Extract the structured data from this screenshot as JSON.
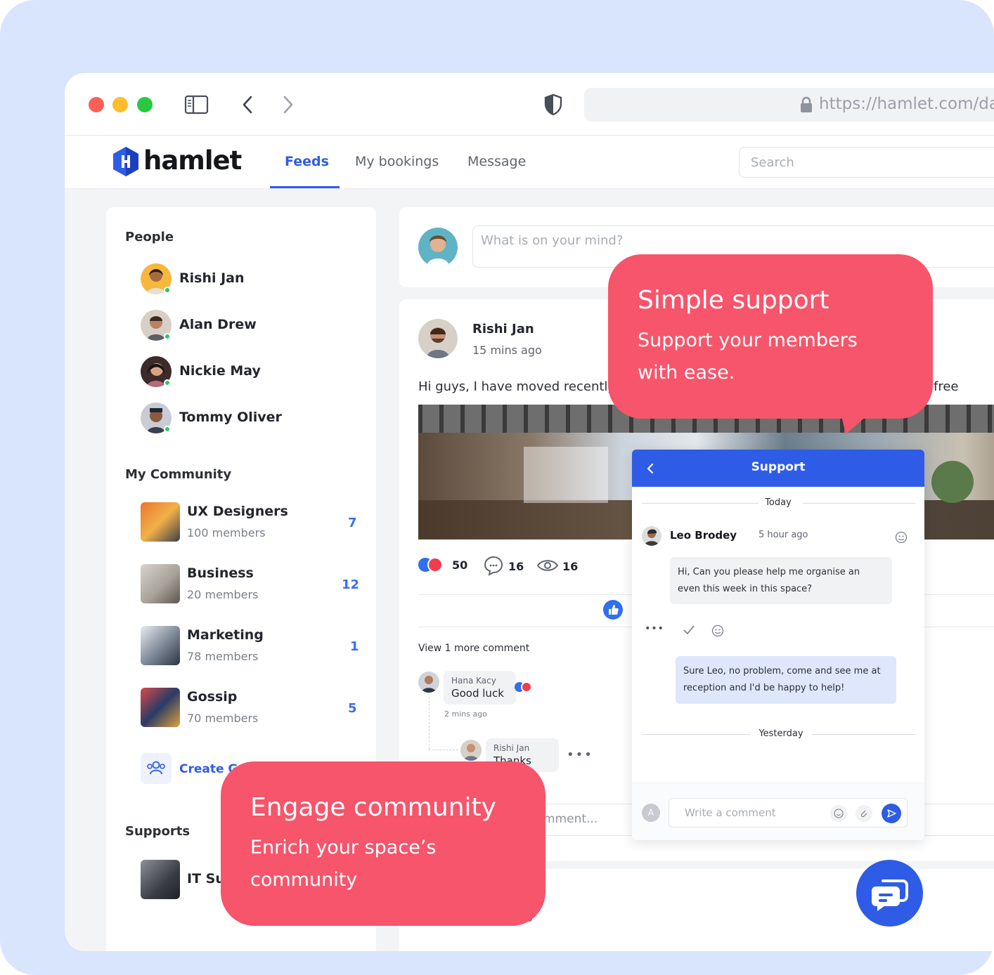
{
  "browser": {
    "url": "https://hamlet.com/das"
  },
  "app": {
    "logo_text": "hamlet",
    "tabs": [
      {
        "label": "Feeds",
        "active": true
      },
      {
        "label": "My bookings",
        "active": false
      },
      {
        "label": "Message",
        "active": false
      }
    ],
    "search_placeholder": "Search"
  },
  "sidebar": {
    "people_title": "People",
    "people": [
      {
        "name": "Rishi Jan",
        "online": true
      },
      {
        "name": "Alan Drew",
        "online": true
      },
      {
        "name": "Nickie May",
        "online": true
      },
      {
        "name": "Tommy Oliver",
        "online": true
      }
    ],
    "community_title": "My Community",
    "communities": [
      {
        "name": "UX Designers",
        "members": "100 members",
        "count": "7"
      },
      {
        "name": "Business",
        "members": "20 members",
        "count": "12"
      },
      {
        "name": "Marketing",
        "members": "78 members",
        "count": "1"
      },
      {
        "name": "Gossip",
        "members": "70 members",
        "count": "5"
      }
    ],
    "create_group": "Create Gr",
    "supports_title": "Supports",
    "support_items": [
      {
        "name": "IT Su"
      }
    ]
  },
  "composer": {
    "placeholder": "What is on your mind?"
  },
  "post": {
    "author": "Rishi Jan",
    "time": "15 mins ago",
    "text_start": "Hi guys, I have moved recently",
    "text_end": "free",
    "reactions": "50",
    "comments": "16",
    "views": "16",
    "view_more": "View 1 more comment",
    "comment_1": {
      "author": "Hana Kacy",
      "text": "Good luck",
      "time": "2 mins ago"
    },
    "reply_1": {
      "author": "Rishi Jan",
      "text": "Thanks"
    },
    "comment_placeholder_fragment": "mment...",
    "next_time_fragment": "go"
  },
  "support_chat": {
    "title": "Support",
    "today": "Today",
    "agent": "Leo Brodey",
    "agent_time": "5 hour ago",
    "msg_in": "Hi, Can you please help me organise an even this week in this space?",
    "msg_out": "Sure Leo, no problem, come and see me at reception and I'd be happy to help!",
    "yesterday": "Yesterday",
    "input_placeholder": "Write a comment",
    "avatar_letter": "A"
  },
  "callouts": {
    "support_title": "Simple support",
    "support_line1": "Support your members",
    "support_line2": "with ease.",
    "community_title": "Engage community",
    "community_line1": "Enrich your space’s",
    "community_line2": "community"
  },
  "colors": {
    "accent": "#2f5ce6",
    "callout": "#f6556b",
    "background": "#d9e5fc"
  }
}
